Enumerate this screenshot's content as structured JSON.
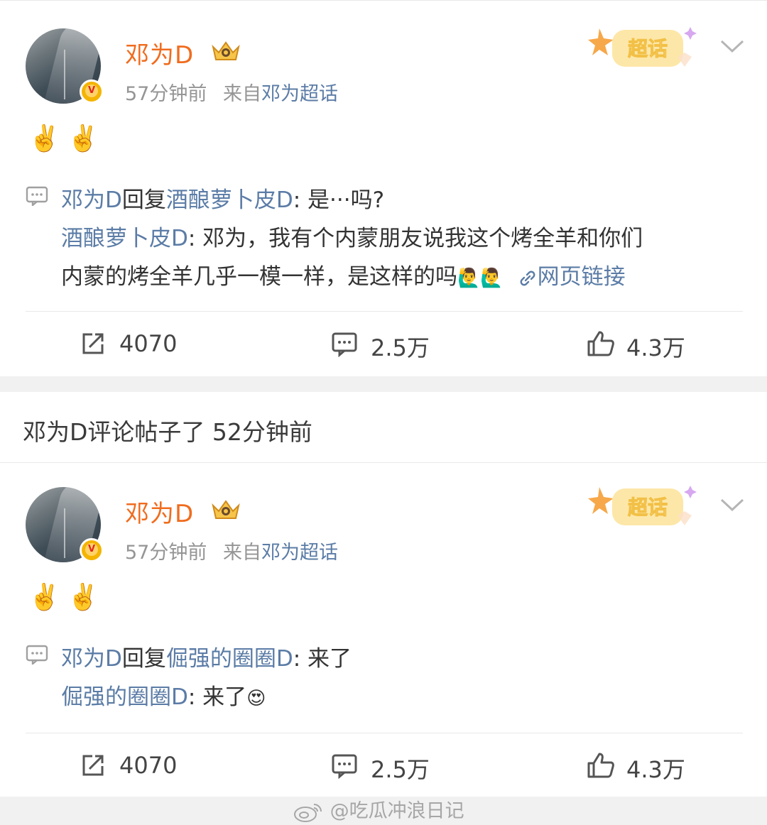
{
  "posts": [
    {
      "author": "邓为D",
      "time": "57分钟前",
      "source_prefix": "来自",
      "source": "邓为超话",
      "chaohua_label": "超话",
      "emojis": "✌️✌️",
      "reply_author": "邓为D",
      "reply_verb": "回复",
      "reply_target": "酒酿萝卜皮D",
      "reply_text": ": 是···吗?",
      "quote_author": "酒酿萝卜皮D",
      "quote_line1": ": 邓为，我有个内蒙朋友说我这个烤全羊和你们",
      "quote_line2": "内蒙的烤全羊几乎一模一样，是这样的吗",
      "quote_emoji": "🙋‍♂️🙋‍♂️",
      "link_text": "网页链接",
      "reposts": "4070",
      "comments": "2.5万",
      "likes": "4.3万"
    },
    {
      "author": "邓为D",
      "time": "57分钟前",
      "source_prefix": "来自",
      "source": "邓为超话",
      "chaohua_label": "超话",
      "emojis": "✌️✌️",
      "reply_author": "邓为D",
      "reply_verb": "回复",
      "reply_target": "倔强的圈圈D",
      "reply_text": ": 来了",
      "quote_author": "倔强的圈圈D",
      "quote_line1": ": 来了",
      "quote_emoji": "😍",
      "reposts": "4070",
      "comments": "2.5万",
      "likes": "4.3万"
    }
  ],
  "section_title": "邓为D评论帖子了 52分钟前",
  "watermark": "@吃瓜冲浪日记",
  "colors": {
    "name": "#f06c1e",
    "link": "#5b7ca6",
    "meta": "#959595",
    "separator_band": "#f1f1f1"
  }
}
